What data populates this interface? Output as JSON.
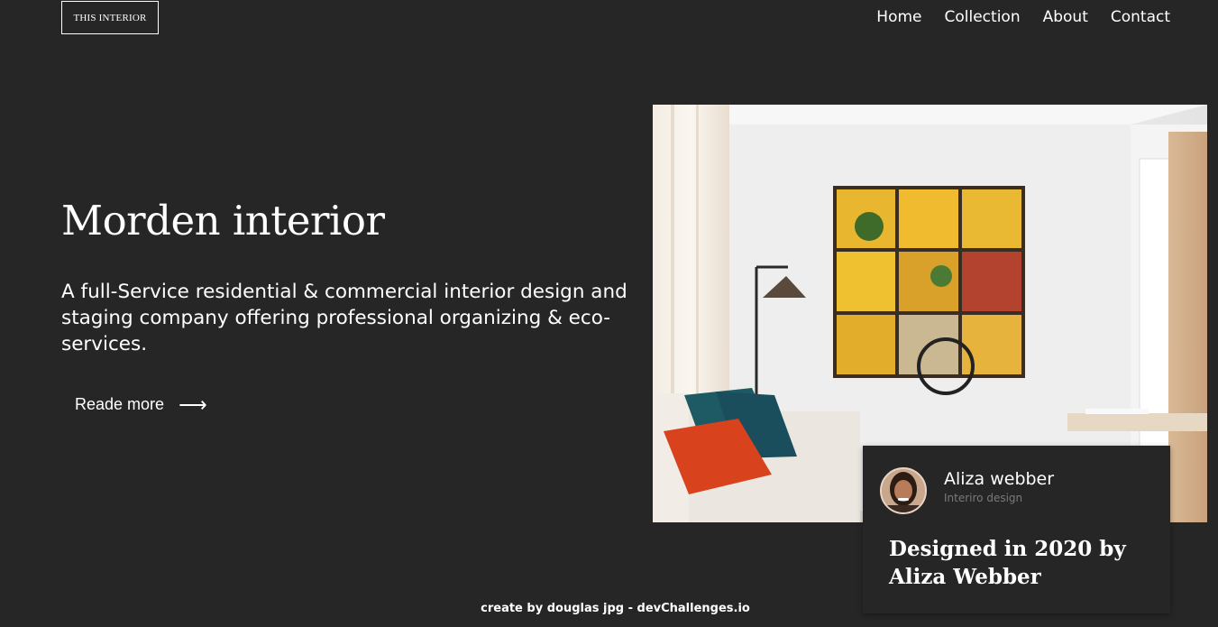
{
  "header": {
    "logo_text": "THIS INTERIOR",
    "nav": [
      {
        "label": "Home"
      },
      {
        "label": "Collection"
      },
      {
        "label": "About"
      },
      {
        "label": "Contact"
      }
    ]
  },
  "hero": {
    "title": "Morden interior",
    "description": "A full-Service residential & commercial interior design and staging company offering professional organizing & eco-services.",
    "cta_label": "Reade more",
    "cta_icon": "arrow-right-icon"
  },
  "card": {
    "name": "Aliza webber",
    "role": "Interiro design",
    "quote": "Designed in 2020 by Aliza Webber"
  },
  "footer": {
    "text": "create by douglas jpg - devChallenges.io"
  },
  "colors": {
    "background": "#262626",
    "text": "#ffffff",
    "muted": "#7a7a7a"
  }
}
